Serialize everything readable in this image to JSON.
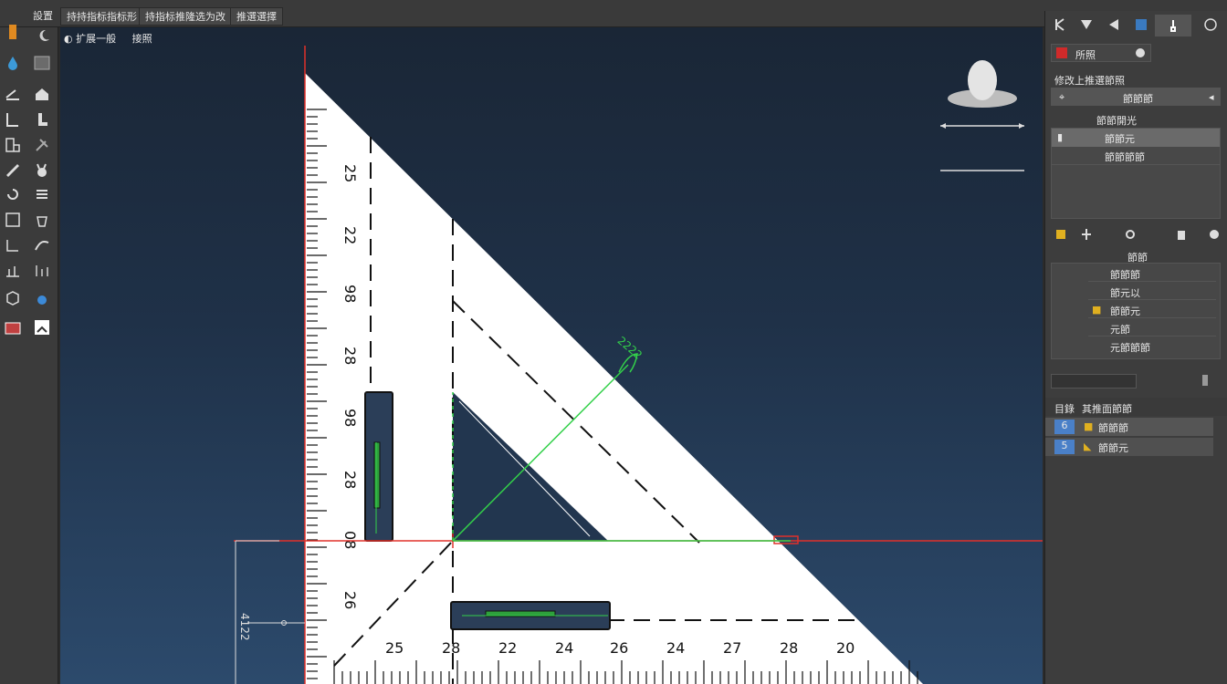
{
  "tabs": [
    "設置",
    "持持指标指标形",
    "持指标推隆选为改",
    "推選選擇"
  ],
  "viewport": {
    "label": "扩展一般",
    "label_extra": "接照",
    "dimension_label": "2222",
    "dimension_side": "4122"
  },
  "ruler_left_ticks": [
    "25",
    "22",
    "98",
    "28",
    "98",
    "28",
    "08",
    "26"
  ],
  "ruler_bottom_ticks": [
    "25",
    "28",
    "22",
    "24",
    "26",
    "24",
    "27",
    "28",
    "20"
  ],
  "right_panel": {
    "tab_label": "所照",
    "section_title": "修改上推選節照",
    "dropdown_value": "節節節",
    "sub_title": "節節開光",
    "list_items": [
      "節節元",
      "節節節節"
    ],
    "group_title": "節節",
    "layer_items": [
      "節節節",
      "節元以",
      "節節元",
      "元節",
      "元節節節"
    ],
    "search_placeholder": "",
    "table_header": [
      "目錄",
      "其推面節節"
    ],
    "table_rows": [
      {
        "id": "6",
        "name": "節節節"
      },
      {
        "id": "5",
        "name": "節節元"
      }
    ]
  },
  "colors": {
    "accent_red": "#e0302a",
    "accent_green": "#33d04a",
    "selection_blue": "#4a80c8",
    "folder_yellow": "#e0b020"
  }
}
